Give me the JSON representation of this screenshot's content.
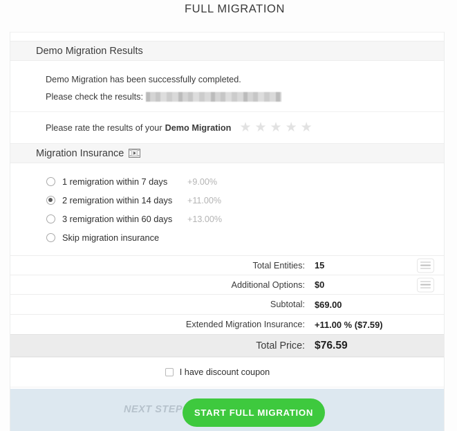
{
  "page": {
    "title": "FULL MIGRATION"
  },
  "demo_results": {
    "section_title": "Demo Migration Results",
    "success_text": "Demo Migration has been successfully completed.",
    "check_results_label": "Please check the results:",
    "results_link_redacted": "",
    "rate_prefix": "Please rate the results of your",
    "rate_bold": "Demo Migration",
    "stars": [
      "★",
      "★",
      "★",
      "★",
      "★"
    ],
    "stars_filled": 0
  },
  "insurance": {
    "section_title": "Migration Insurance",
    "video_icon": "video-icon",
    "options": [
      {
        "label": "1 remigration within 7 days",
        "percent": "+9.00%",
        "selected": false
      },
      {
        "label": "2 remigration within 14 days",
        "percent": "+11.00%",
        "selected": true
      },
      {
        "label": "3 remigration within 60 days",
        "percent": "+13.00%",
        "selected": false
      },
      {
        "label": "Skip migration insurance",
        "percent": "",
        "selected": false
      }
    ]
  },
  "totals": {
    "rows": [
      {
        "label": "Total Entities:",
        "value": "15",
        "has_list_button": true
      },
      {
        "label": "Additional Options:",
        "value": "$0",
        "has_list_button": true
      },
      {
        "label": "Subtotal:",
        "value": "$69.00",
        "has_list_button": false
      },
      {
        "label": "Extended Migration Insurance:",
        "value": "+11.00 % ($7.59)",
        "has_list_button": false
      }
    ],
    "grand": {
      "label": "Total Price:",
      "value": "$76.59"
    }
  },
  "coupon": {
    "label": "I have discount coupon",
    "checked": false
  },
  "footer": {
    "next_step_label": "NEXT STEP",
    "start_button_label": "START FULL MIGRATION",
    "button_color": "#3ec93e",
    "background_color": "#dde8f0"
  }
}
